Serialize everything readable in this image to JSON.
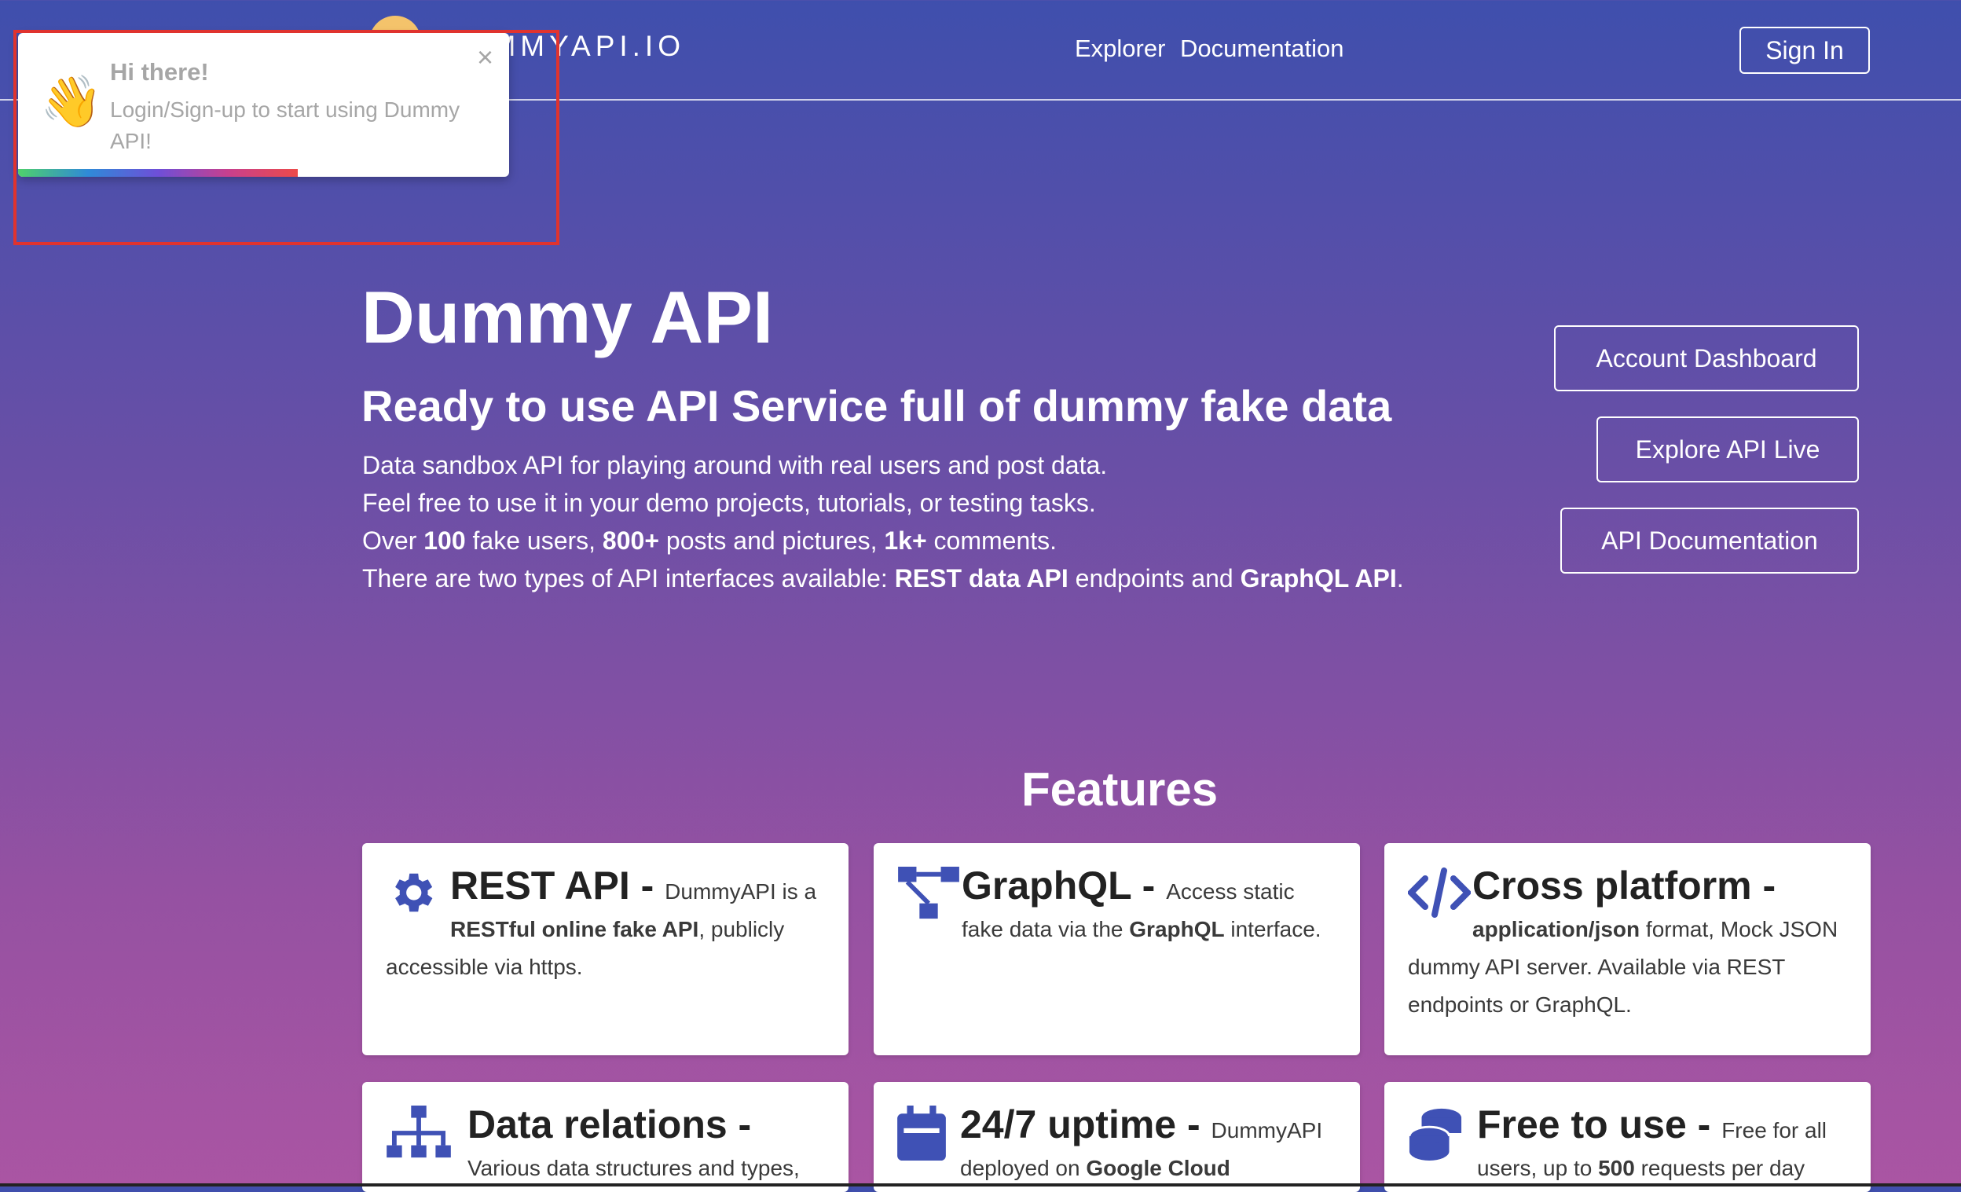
{
  "nav": {
    "logo_text": "DUMMYAPI.IO",
    "links": [
      "Explorer",
      "Documentation"
    ],
    "sign_in": "Sign In"
  },
  "toast": {
    "emoji": "👋",
    "title": "Hi there!",
    "message": "Login/Sign-up to start using Dummy API!",
    "close": "×",
    "progress": 0.57
  },
  "hero": {
    "title": "Dummy API",
    "subtitle": "Ready to use API Service full of dummy fake data",
    "line1": "Data sandbox API for playing around with real users and post data.",
    "line2": "Feel free to use it in your demo projects, tutorials, or testing tasks.",
    "line3_pre": "Over ",
    "line3_b1": "100",
    "line3_mid1": " fake users, ",
    "line3_b2": "800+",
    "line3_mid2": " posts and pictures, ",
    "line3_b3": "1k+",
    "line3_post": " comments.",
    "line4_pre": "There are two types of API interfaces available: ",
    "line4_b1": "REST data API",
    "line4_mid": " endpoints and ",
    "line4_b2": "GraphQL API",
    "line4_post": "."
  },
  "side_buttons": [
    "Account Dashboard",
    "Explore API Live",
    "API Documentation"
  ],
  "features": {
    "title": "Features",
    "cards": [
      {
        "title": "REST API - ",
        "pre": "DummyAPI is a ",
        "b": "RESTful online fake API",
        "post": ", publicly accessible via https.",
        "icon": "gear-icon"
      },
      {
        "title": "GraphQL - ",
        "pre": "Access static fake data via the ",
        "b": "GraphQL",
        "post": " interface.",
        "icon": "graph-icon"
      },
      {
        "title": "Cross platform - ",
        "pre": "",
        "b": "application/json",
        "post": " format, Mock JSON dummy API server. Available via REST endpoints or GraphQL.",
        "icon": "code-icon"
      },
      {
        "title": "Data relations - ",
        "pre": "Various data structures and types, with a",
        "b": "",
        "post": "",
        "icon": "sitemap-icon"
      },
      {
        "title": "24/7 uptime - ",
        "pre": "DummyAPI deployed on ",
        "b": "Google Cloud",
        "post": "",
        "icon": "calendar-icon"
      },
      {
        "title": "Free to use - ",
        "pre": "Free for all users, up to ",
        "b": "500",
        "post": " requests per day",
        "icon": "coins-icon"
      }
    ]
  },
  "colors": {
    "accent": "#3f51b5",
    "bg_top": "#3f4fad",
    "bg_bottom": "#aa55a3",
    "highlight": "#e0332e"
  }
}
